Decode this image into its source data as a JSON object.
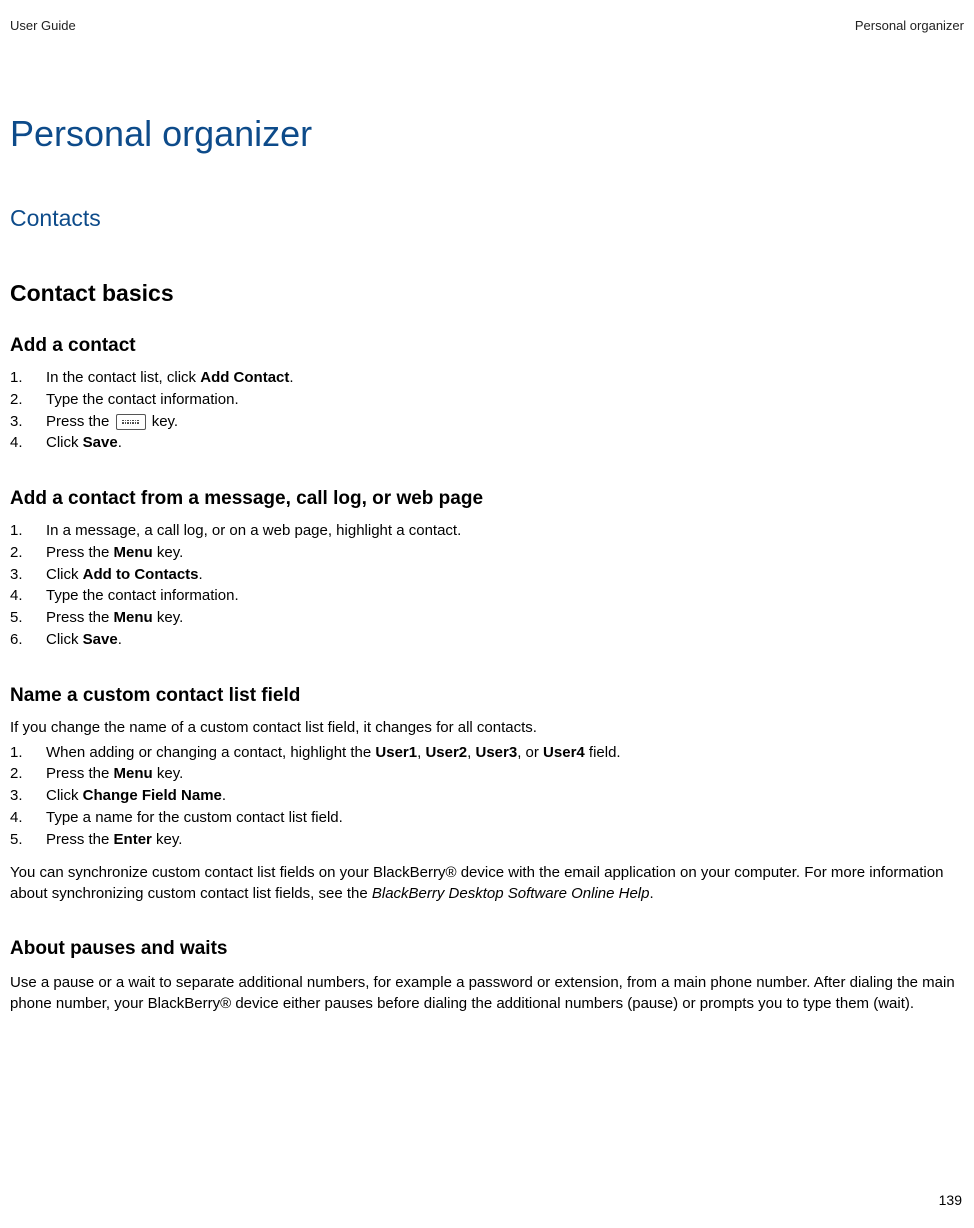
{
  "header": {
    "left": "User Guide",
    "right": "Personal organizer"
  },
  "h1": "Personal organizer",
  "h2": "Contacts",
  "h3": "Contact basics",
  "sections": {
    "add_contact": {
      "title": "Add a contact",
      "items": [
        {
          "n": "1.",
          "pre": "In the contact list, click ",
          "bold": "Add Contact",
          "post": "."
        },
        {
          "n": "2.",
          "pre": "Type the contact information.",
          "bold": "",
          "post": ""
        },
        {
          "n": "3.",
          "pre": "Press the ",
          "icon": true,
          "post": " key."
        },
        {
          "n": "4.",
          "pre": "Click ",
          "bold": "Save",
          "post": "."
        }
      ]
    },
    "add_from_msg": {
      "title": "Add a contact from a message, call log, or web page",
      "items": [
        {
          "n": "1.",
          "pre": "In a message, a call log, or on a web page, highlight a contact.",
          "bold": "",
          "post": ""
        },
        {
          "n": "2.",
          "pre": "Press the ",
          "bold": "Menu",
          "post": " key."
        },
        {
          "n": "3.",
          "pre": "Click ",
          "bold": "Add to Contacts",
          "post": "."
        },
        {
          "n": "4.",
          "pre": "Type the contact information.",
          "bold": "",
          "post": ""
        },
        {
          "n": "5.",
          "pre": "Press the ",
          "bold": "Menu",
          "post": " key."
        },
        {
          "n": "6.",
          "pre": "Click ",
          "bold": "Save",
          "post": "."
        }
      ]
    },
    "name_field": {
      "title": "Name a custom contact list field",
      "intro": "If you change the name of a custom contact list field, it changes for all contacts.",
      "items": [
        {
          "n": "1.",
          "html": "When adding or changing a contact, highlight the <b>User1</b>, <b>User2</b>, <b>User3</b>, or <b>User4</b> field."
        },
        {
          "n": "2.",
          "pre": "Press the ",
          "bold": "Menu",
          "post": " key."
        },
        {
          "n": "3.",
          "pre": "Click ",
          "bold": "Change Field Name",
          "post": "."
        },
        {
          "n": "4.",
          "pre": "Type a name for the custom contact list field.",
          "bold": "",
          "post": ""
        },
        {
          "n": "5.",
          "pre": "Press the ",
          "bold": "Enter",
          "post": " key."
        }
      ],
      "outro_pre": "You can synchronize custom contact list fields on your BlackBerry® device with the email application on your computer. For more information about synchronizing custom contact list fields, see the  ",
      "outro_italic": "BlackBerry Desktop Software Online Help",
      "outro_post": "."
    },
    "pauses": {
      "title": "About pauses and waits",
      "para": "Use a pause or a wait to separate additional numbers, for example a password or extension, from a main phone number. After dialing the main phone number, your BlackBerry® device either pauses before dialing the additional numbers (pause) or prompts you to type them (wait)."
    }
  },
  "footer": "139"
}
